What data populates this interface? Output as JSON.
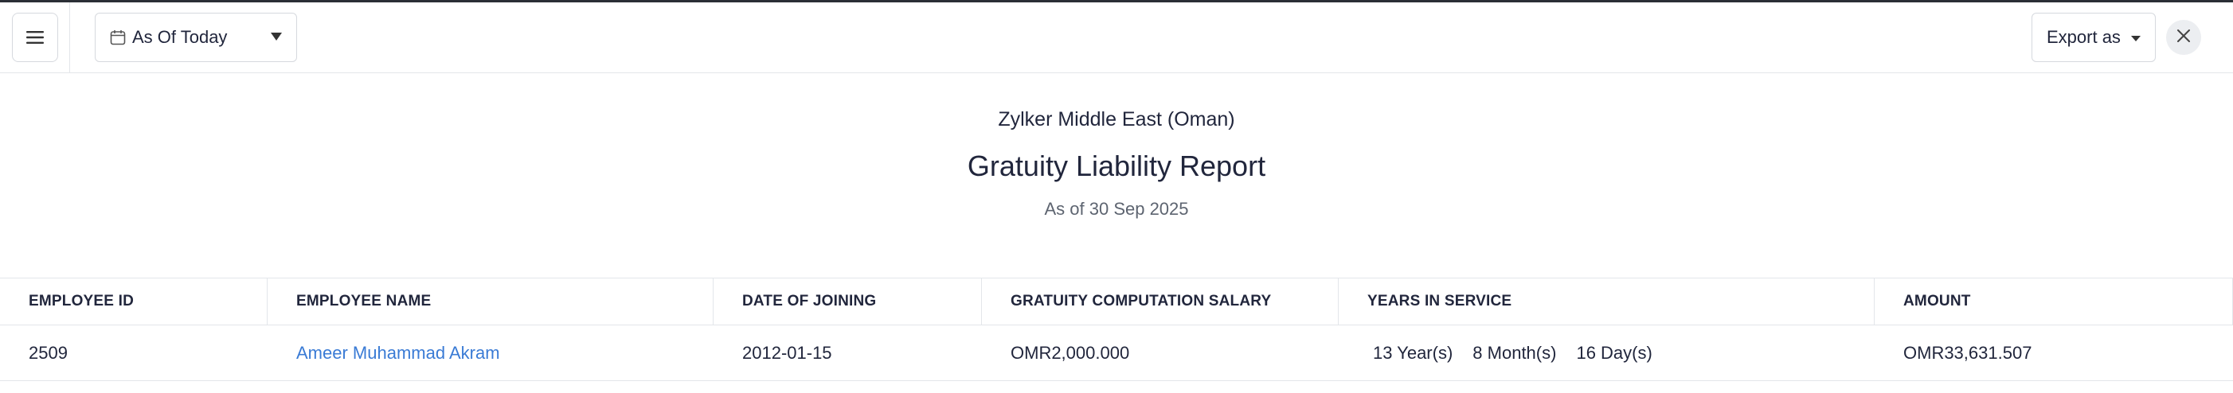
{
  "toolbar": {
    "date_filter_label": "As Of Today",
    "export_label": "Export as"
  },
  "report": {
    "organization": "Zylker Middle East (Oman)",
    "title": "Gratuity Liability Report",
    "as_of": "As of 30 Sep 2025"
  },
  "table": {
    "columns": [
      "EMPLOYEE ID",
      "EMPLOYEE NAME",
      "DATE OF JOINING",
      "GRATUITY COMPUTATION SALARY",
      "YEARS IN SERVICE",
      "AMOUNT"
    ],
    "rows": [
      {
        "employee_id": "2509",
        "employee_name": "Ameer Muhammad Akram",
        "date_of_joining": "2012-01-15",
        "salary": "OMR2,000.000",
        "service_years": "13 Year(s)",
        "service_months": "8 Month(s)",
        "service_days": "16 Day(s)",
        "amount": "OMR33,631.507"
      }
    ]
  },
  "icons": {
    "menu": "hamburger-menu-icon",
    "calendar": "calendar-icon",
    "dropdown": "caret-down-icon",
    "close": "close-icon"
  },
  "colors": {
    "link": "#3a7bd5",
    "border": "#e3e6ea",
    "text": "#21263c"
  }
}
